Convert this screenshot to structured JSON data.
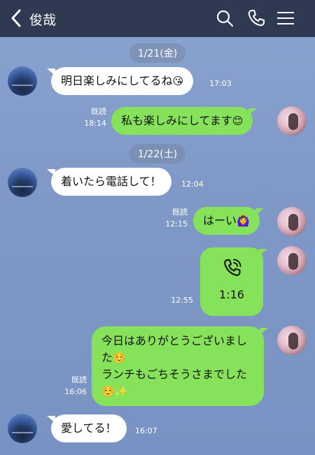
{
  "header": {
    "title": "俊哉"
  },
  "dates": [
    "1/21(金)",
    "1/22(土)"
  ],
  "messages": {
    "m1": {
      "text": "明日楽しみにしてるね",
      "emoji": "😘",
      "time": "17:03"
    },
    "m2": {
      "read": "既読",
      "time": "18:14",
      "text": "私も楽しみにしてます",
      "emoji": "😊"
    },
    "m3": {
      "text": "着いたら電話して！",
      "time": "12:04"
    },
    "m4": {
      "read": "既読",
      "time": "12:15",
      "text": "はーい",
      "emoji": "🙆‍♀️"
    },
    "m5": {
      "time": "12:55",
      "call_duration": "1:16"
    },
    "m6": {
      "read": "既読",
      "time": "16:06",
      "line1": "今日はありがとうございまし",
      "line2": "た",
      "emoji1": "☺️",
      "line3": "ランチもごちそうさまでした",
      "emoji2": "☺️✨"
    },
    "m7": {
      "text": "愛してる！",
      "time": "16:07"
    }
  }
}
